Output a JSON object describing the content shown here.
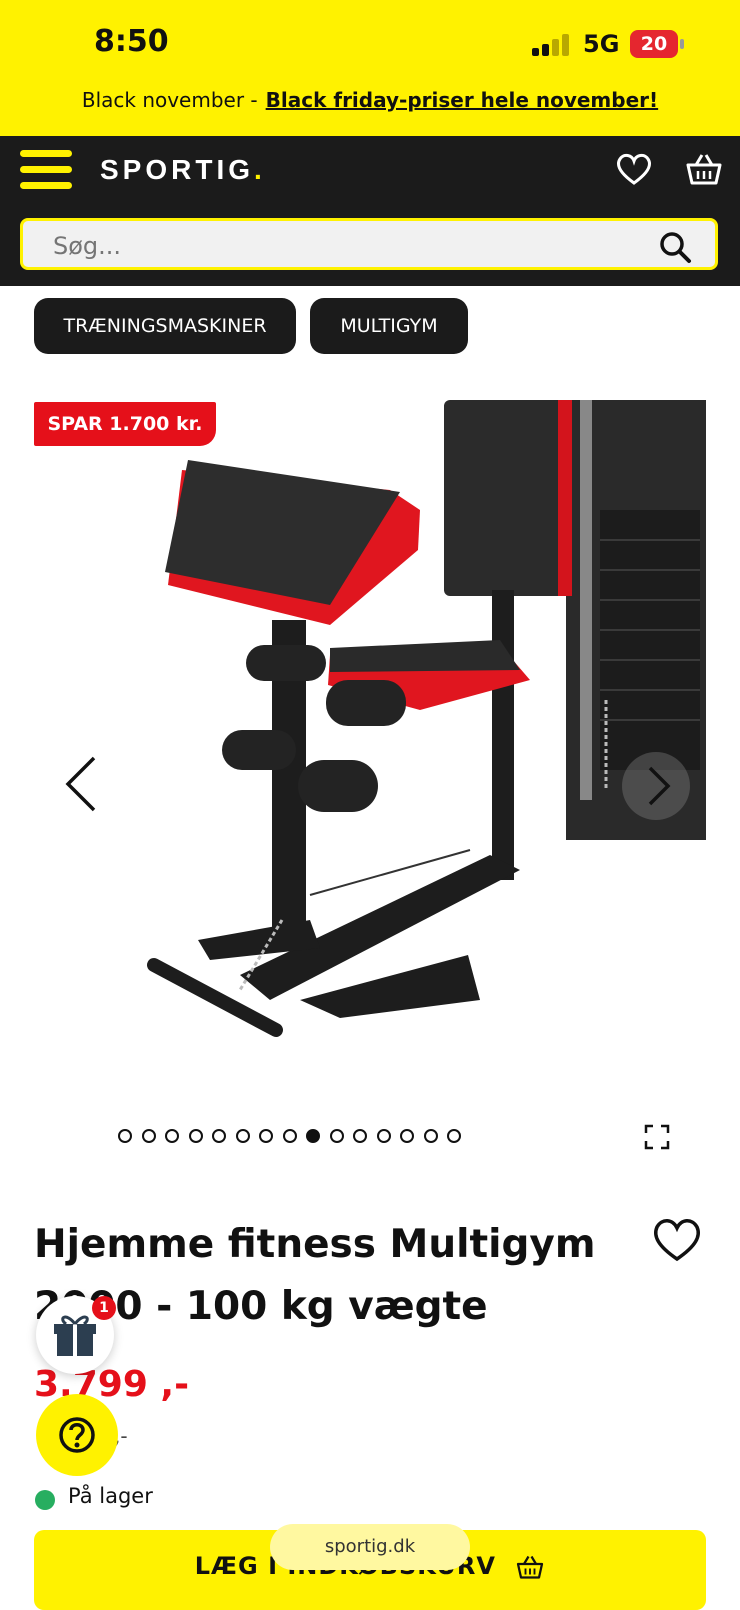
{
  "status": {
    "time": "8:50",
    "network": "5G",
    "battery": "20"
  },
  "promo": {
    "text": "Black november -",
    "link": "Black friday-priser hele november!"
  },
  "header": {
    "logo": "SPORTIG",
    "logo_dot": "."
  },
  "search": {
    "placeholder": "Søg..."
  },
  "categories": [
    "TRÆNINGSMASKINER",
    "MULTIGYM"
  ],
  "gallery": {
    "badge": "SPAR 1.700 kr.",
    "image_count": 15,
    "active_index": 8
  },
  "product": {
    "title": "Hjemme fitness Multigym 2000 - 100 kg vægte",
    "price": "3.799 ,-",
    "old_price": ",-",
    "stock": "På lager"
  },
  "floating": {
    "gift_count": "1"
  },
  "cart": {
    "label": "LÆG I INDKØBSKURV"
  },
  "browser": {
    "url": "sportig.dk"
  },
  "colors": {
    "brand_yellow": "#fff200",
    "dark": "#1b1b1b",
    "sale_red": "#e5101a",
    "stock_green": "#27ae60"
  }
}
